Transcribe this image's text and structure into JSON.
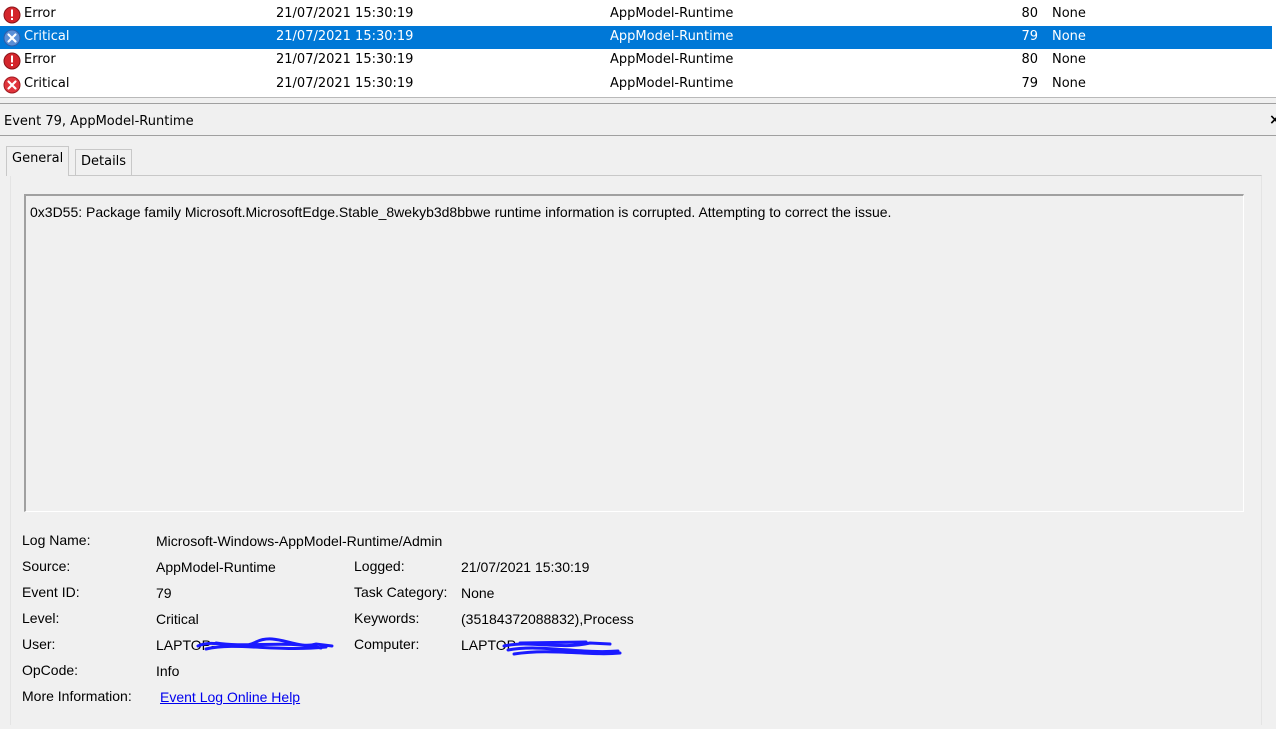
{
  "events": [
    {
      "level": "Error",
      "date": "21/07/2021 15:30:19",
      "source": "AppModel-Runtime",
      "event_id": "80",
      "task": "None",
      "icon": "error-icon",
      "selected": false
    },
    {
      "level": "Critical",
      "date": "21/07/2021 15:30:19",
      "source": "AppModel-Runtime",
      "event_id": "79",
      "task": "None",
      "icon": "critical-icon",
      "selected": true
    },
    {
      "level": "Error",
      "date": "21/07/2021 15:30:19",
      "source": "AppModel-Runtime",
      "event_id": "80",
      "task": "None",
      "icon": "error-icon",
      "selected": false
    },
    {
      "level": "Critical",
      "date": "21/07/2021 15:30:19",
      "source": "AppModel-Runtime",
      "event_id": "79",
      "task": "None",
      "icon": "critical-icon",
      "selected": false
    }
  ],
  "detail": {
    "title": "Event 79, AppModel-Runtime",
    "close_glyph": "×",
    "tabs": [
      {
        "label": "General",
        "active": true
      },
      {
        "label": "Details",
        "active": false
      }
    ],
    "description": "0x3D55: Package family Microsoft.MicrosoftEdge.Stable_8wekyb3d8bbwe runtime information is corrupted. Attempting to correct the issue.",
    "properties": {
      "log_name_label": "Log Name:",
      "log_name_value": "Microsoft-Windows-AppModel-Runtime/Admin",
      "source_label": "Source:",
      "source_value": "AppModel-Runtime",
      "logged_label": "Logged:",
      "logged_value": "21/07/2021 15:30:19",
      "event_id_label": "Event ID:",
      "event_id_value": "79",
      "task_category_label": "Task Category:",
      "task_category_value": "None",
      "level_label": "Level:",
      "level_value": "Critical",
      "keywords_label": "Keywords:",
      "keywords_value": "(35184372088832),Process",
      "user_label": "User:",
      "user_value": "LAPTOP-",
      "computer_label": "Computer:",
      "computer_value": "LAPTOP",
      "opcode_label": "OpCode:",
      "opcode_value": "Info",
      "more_info_label": "More Information:",
      "more_info_link": "Event Log Online Help"
    }
  },
  "colors": {
    "selection": "#0078d7",
    "error_red": "#d4262c",
    "critical_red": "#e0353c",
    "link_blue": "#0000ee",
    "redaction_blue": "#1a1aff"
  }
}
